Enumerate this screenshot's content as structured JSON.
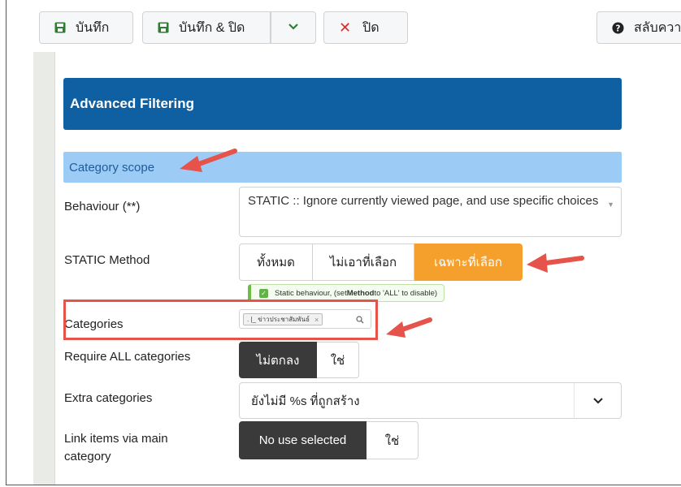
{
  "toolbar": {
    "save_label": "บันทึก",
    "save_close_label": "บันทึก & ปิด",
    "close_label": "ปิด",
    "help_label": "สลับควา"
  },
  "section": {
    "title": "Advanced Filtering",
    "scope_title": "Category scope"
  },
  "fields": {
    "behaviour": {
      "label": "Behaviour (**)",
      "value": "STATIC :: Ignore currently viewed page, and use specific choices"
    },
    "static_method": {
      "label": "STATIC Method",
      "options": [
        "ทั้งหมด",
        "ไม่เอาที่เลือก",
        "เฉพาะที่เลือก"
      ],
      "selected": "เฉพาะที่เลือก",
      "note_text_before": "Static behaviour, (set ",
      "note_text_bold": "Method",
      "note_text_after": " to 'ALL' to disable)"
    },
    "categories": {
      "label": "Categories",
      "tag": ". |_ ข่าวประชาสัมพันธ์"
    },
    "require_all": {
      "label": "Require ALL categories",
      "options": [
        "ไม่ตกลง",
        "ใช่"
      ],
      "selected": "ไม่ตกลง"
    },
    "extra_categories": {
      "label": "Extra categories",
      "value": "ยังไม่มี %s ที่ถูกสร้าง"
    },
    "link_items": {
      "label_line1": "Link items via main",
      "label_line2": "category",
      "options": [
        "No use selected",
        "ใช่"
      ],
      "selected": "No use selected"
    }
  },
  "colors": {
    "header_blue": "#0f5fa3",
    "scope_blue": "#9ccbf5",
    "accent_orange": "#f5a02c",
    "annotation_red": "#e5534b",
    "save_green": "#2e7d32"
  },
  "icons": [
    "save-icon",
    "chevron-down-icon",
    "close-icon",
    "help-icon",
    "search-icon",
    "check-icon",
    "annotation-arrow-icon"
  ]
}
